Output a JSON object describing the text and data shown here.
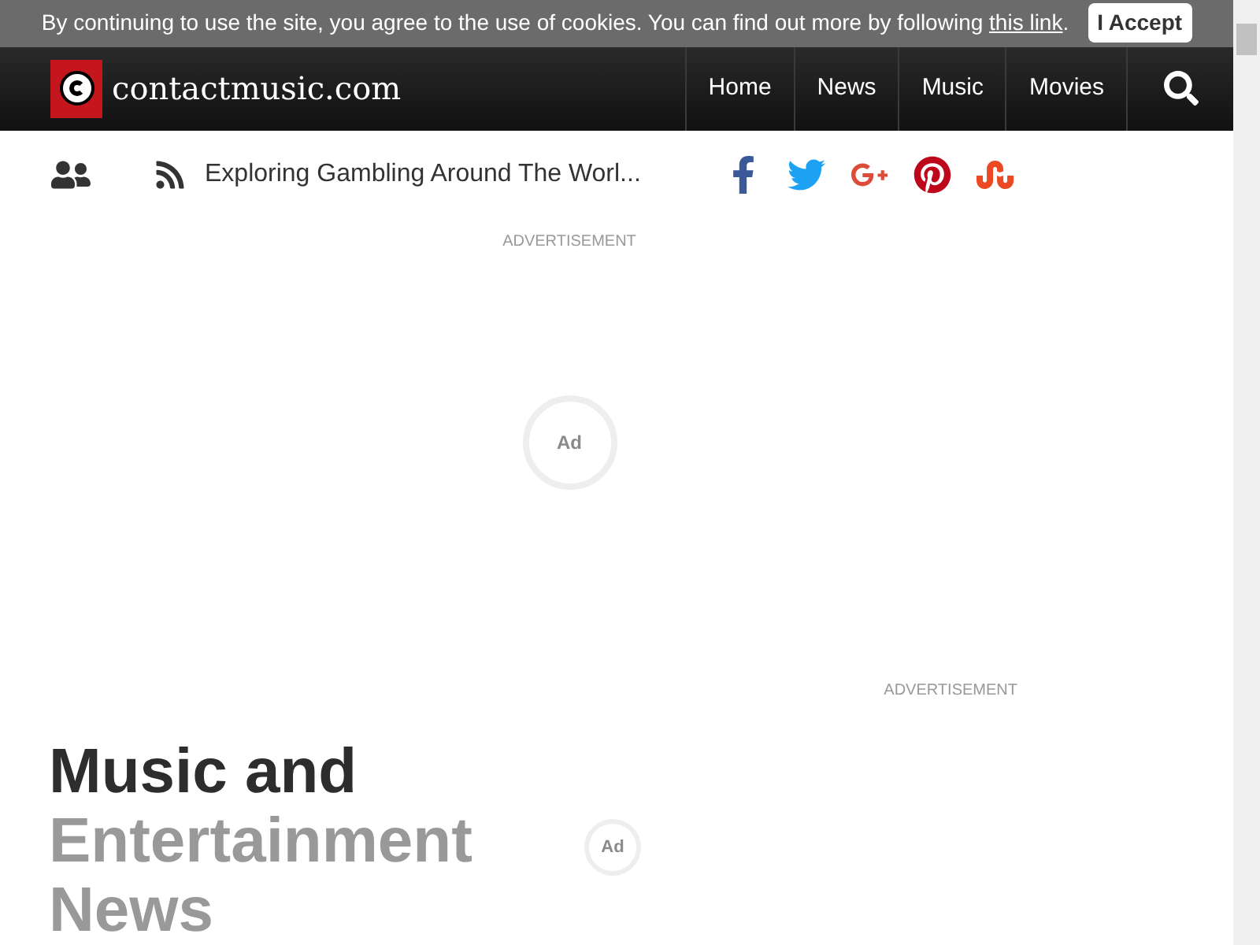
{
  "cookie_banner": {
    "text": "By continuing to use the site, you agree to the use of cookies. You can find out more by following",
    "link": "this link",
    "after_link": ".",
    "button": "I Accept"
  },
  "header": {
    "logo_text": "contactmusic.com",
    "nav": [
      {
        "label": "Home"
      },
      {
        "label": "News"
      },
      {
        "label": "Music"
      },
      {
        "label": "Movies"
      }
    ]
  },
  "subbar": {
    "headline": "Exploring Gambling Around The Worl...",
    "social": [
      {
        "kind": "facebook",
        "color": "#3b5998"
      },
      {
        "kind": "twitter",
        "color": "#1da1f2"
      },
      {
        "kind": "googleplus",
        "color": "#dd4b39"
      },
      {
        "kind": "pinterest",
        "color": "#bd081c"
      },
      {
        "kind": "stumbleupon",
        "color": "#eb4924"
      }
    ]
  },
  "ads": [
    {
      "label": "ADVERTISEMENT",
      "badge": "Ad"
    },
    {
      "label": "ADVERTISEMENT",
      "badge": "Ad"
    }
  ],
  "heading": {
    "first": "Music and",
    "rest": "Entertainment News"
  }
}
